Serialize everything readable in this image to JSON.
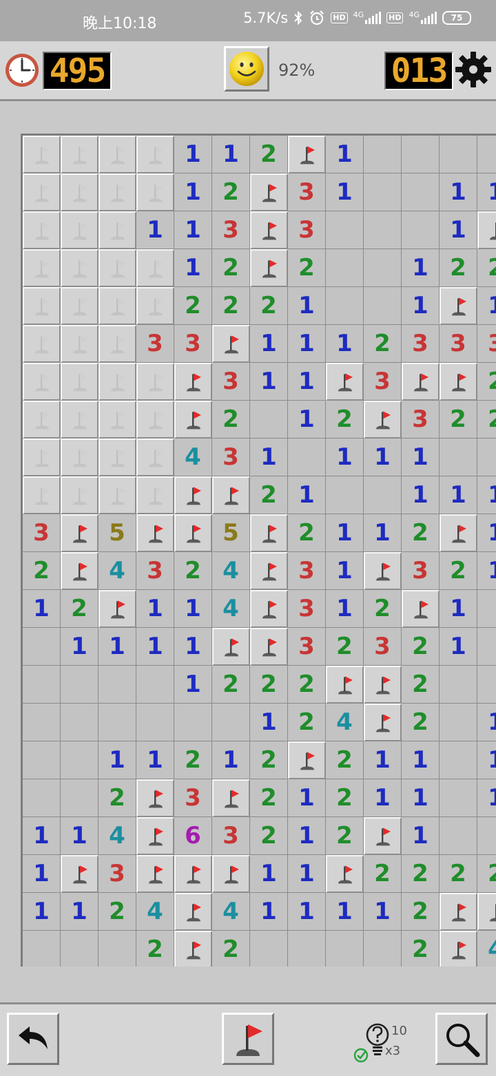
{
  "status_bar": {
    "time": "晚上10:18",
    "net_speed": "5.7K/s",
    "hd1": "HD",
    "hd2": "HD",
    "sig1": "4G",
    "sig2": "4G",
    "battery": "75",
    "icons": [
      "bluetooth-icon",
      "alarm-icon",
      "signal-icon",
      "battery-icon"
    ]
  },
  "header": {
    "timer": "495",
    "percent": "92%",
    "mines_left": "013",
    "icons": [
      "clock-icon",
      "smiley-icon",
      "gear-icon"
    ]
  },
  "colors": {
    "1": "#1e2bc0",
    "2": "#1f8d2a",
    "3": "#c83535",
    "4": "#1b8f9f",
    "5": "#8a7a1a",
    "6": "#a51bb0",
    "lcd": "#e9a82b",
    "flag": "#e22b2b"
  },
  "board": {
    "legend": "U = unopened (faded flag), F = flagged, digits = numbers, 0 = empty",
    "rows": [
      [
        "U",
        "U",
        "U",
        "U",
        "1",
        "1",
        "2",
        "F",
        "1",
        "0",
        "0",
        "0",
        "0"
      ],
      [
        "U",
        "U",
        "U",
        "U",
        "1",
        "2",
        "F",
        "3",
        "1",
        "0",
        "0",
        "1",
        "1"
      ],
      [
        "U",
        "U",
        "U",
        "1",
        "1",
        "3",
        "F",
        "3",
        "0",
        "0",
        "0",
        "1",
        "F"
      ],
      [
        "U",
        "U",
        "U",
        "U",
        "1",
        "2",
        "F",
        "2",
        "0",
        "0",
        "1",
        "2",
        "2"
      ],
      [
        "U",
        "U",
        "U",
        "U",
        "2",
        "2",
        "2",
        "1",
        "0",
        "0",
        "1",
        "F",
        "1"
      ],
      [
        "U",
        "U",
        "U",
        "3",
        "3",
        "F",
        "1",
        "1",
        "1",
        "2",
        "3",
        "3",
        "3"
      ],
      [
        "U",
        "U",
        "U",
        "U",
        "F",
        "3",
        "1",
        "1",
        "F",
        "3",
        "F",
        "F",
        "2"
      ],
      [
        "U",
        "U",
        "U",
        "U",
        "F",
        "2",
        "0",
        "1",
        "2",
        "F",
        "3",
        "2",
        "2"
      ],
      [
        "U",
        "U",
        "U",
        "U",
        "4",
        "3",
        "1",
        "0",
        "1",
        "1",
        "1",
        "0",
        "0"
      ],
      [
        "U",
        "U",
        "U",
        "U",
        "F",
        "F",
        "2",
        "1",
        "0",
        "0",
        "1",
        "1",
        "1"
      ],
      [
        "3",
        "F",
        "5",
        "F",
        "F",
        "5",
        "F",
        "2",
        "1",
        "1",
        "2",
        "F",
        "1"
      ],
      [
        "2",
        "F",
        "4",
        "3",
        "2",
        "4",
        "F",
        "3",
        "1",
        "F",
        "3",
        "2",
        "1"
      ],
      [
        "1",
        "2",
        "F",
        "1",
        "1",
        "4",
        "F",
        "3",
        "1",
        "2",
        "F",
        "1",
        "0"
      ],
      [
        "0",
        "1",
        "1",
        "1",
        "1",
        "F",
        "F",
        "3",
        "2",
        "3",
        "2",
        "1",
        "0"
      ],
      [
        "0",
        "0",
        "0",
        "0",
        "1",
        "2",
        "2",
        "2",
        "F",
        "F",
        "2",
        "0",
        "0"
      ],
      [
        "0",
        "0",
        "0",
        "0",
        "0",
        "0",
        "1",
        "2",
        "4",
        "F",
        "2",
        "0",
        "1"
      ],
      [
        "0",
        "0",
        "1",
        "1",
        "2",
        "1",
        "2",
        "F",
        "2",
        "1",
        "1",
        "0",
        "1"
      ],
      [
        "0",
        "0",
        "2",
        "F",
        "3",
        "F",
        "2",
        "1",
        "2",
        "1",
        "1",
        "0",
        "1"
      ],
      [
        "1",
        "1",
        "4",
        "F",
        "6",
        "3",
        "2",
        "1",
        "2",
        "F",
        "1",
        "0",
        "0"
      ],
      [
        "1",
        "F",
        "3",
        "F",
        "F",
        "F",
        "1",
        "1",
        "F",
        "2",
        "2",
        "2",
        "2"
      ],
      [
        "1",
        "1",
        "2",
        "4",
        "F",
        "4",
        "1",
        "1",
        "1",
        "1",
        "2",
        "F",
        "F"
      ],
      [
        "0",
        "0",
        "0",
        "2",
        "F",
        "2",
        "0",
        "0",
        "0",
        "0",
        "2",
        "F",
        "4"
      ]
    ]
  },
  "toolbar": {
    "hint_count": "10",
    "hint_multiplier": "x3",
    "icons": [
      "undo-icon",
      "flag-mode-icon",
      "hint-icon",
      "zoom-icon"
    ]
  }
}
